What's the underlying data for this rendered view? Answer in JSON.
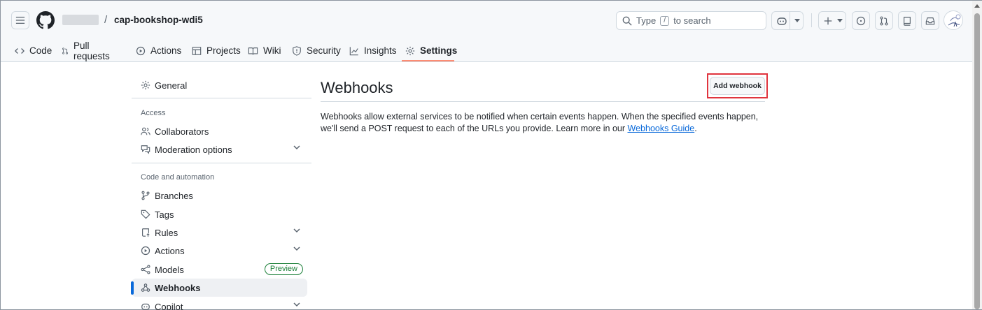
{
  "header": {
    "repo_name": "cap-bookshop-wdi5",
    "separator": "/",
    "search": {
      "prefix": "Type",
      "key": "/",
      "suffix": "to search"
    }
  },
  "tabs": [
    {
      "label": "Code",
      "icon": "code-icon"
    },
    {
      "label": "Pull requests",
      "icon": "git-pull-request-icon"
    },
    {
      "label": "Actions",
      "icon": "play-icon"
    },
    {
      "label": "Projects",
      "icon": "table-icon"
    },
    {
      "label": "Wiki",
      "icon": "book-icon"
    },
    {
      "label": "Security",
      "icon": "shield-icon"
    },
    {
      "label": "Insights",
      "icon": "graph-icon"
    },
    {
      "label": "Settings",
      "icon": "gear-icon",
      "selected": true
    }
  ],
  "sidebar": {
    "general": "General",
    "access_heading": "Access",
    "collaborators": "Collaborators",
    "moderation": "Moderation options",
    "code_heading": "Code and automation",
    "branches": "Branches",
    "tags": "Tags",
    "rules": "Rules",
    "actions": "Actions",
    "models": "Models",
    "models_badge": "Preview",
    "webhooks": "Webhooks",
    "copilot": "Copilot"
  },
  "main": {
    "title": "Webhooks",
    "add_button": "Add webhook",
    "description": "Webhooks allow external services to be notified when certain events happen. When the specified events happen, we'll send a POST request to each of the URLs you provide. Learn more in our",
    "link": "Webhooks Guide",
    "description_end": "."
  },
  "colors": {
    "accent": "#0969da",
    "tab_underline": "#fd8c73",
    "highlight": "#e0343e",
    "badge": "#1a7f37"
  }
}
